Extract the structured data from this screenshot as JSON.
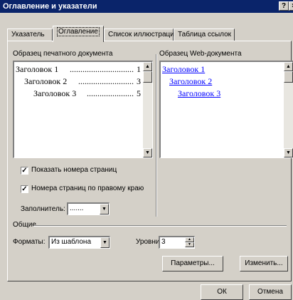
{
  "window": {
    "title": "Оглавление и указатели",
    "help_button": "?",
    "close_button": "×"
  },
  "tabs": [
    {
      "label": "Указатель",
      "active": false
    },
    {
      "label": "Оглавление",
      "active": true
    },
    {
      "label": "Список иллюстраций",
      "active": false
    },
    {
      "label": "Таблица ссылок",
      "active": false
    }
  ],
  "print_preview": {
    "label": "Образец печатного документа",
    "lines": [
      {
        "text": "Заголовок 1",
        "page": "1"
      },
      {
        "text": "Заголовок 2",
        "page": "3"
      },
      {
        "text": "Заголовок 3",
        "page": "5"
      }
    ]
  },
  "web_preview": {
    "label": "Образец Web-документа",
    "links": [
      "Заголовок 1",
      "Заголовок 2",
      "Заголовок 3"
    ]
  },
  "options": {
    "show_page_numbers": {
      "label": "Показать номера страниц",
      "checked": true
    },
    "right_align_numbers": {
      "label": "Номера страниц по правому краю",
      "checked": true
    },
    "filler": {
      "label": "Заполнитель:",
      "value": "......."
    }
  },
  "general": {
    "label": "Общие",
    "formats": {
      "label": "Форматы:",
      "value": "Из шаблона"
    },
    "levels": {
      "label": "Уровни:",
      "value": "3"
    }
  },
  "buttons": {
    "params": "Параметры...",
    "modify": "Изменить...",
    "ok": "ОК",
    "cancel": "Отмена"
  }
}
